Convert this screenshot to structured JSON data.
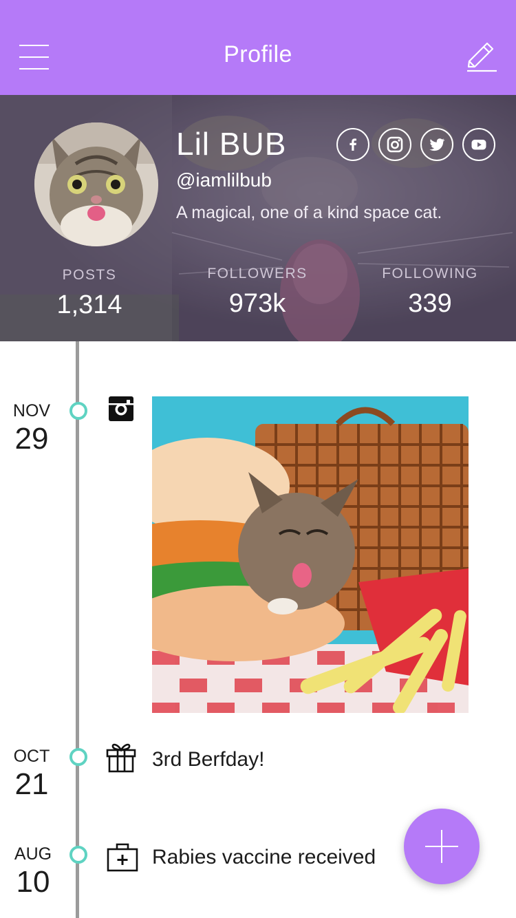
{
  "header": {
    "title": "Profile",
    "menu_icon": "hamburger-menu-icon",
    "edit_icon": "pencil-edit-icon",
    "background_color": "#b57af8"
  },
  "profile": {
    "name": "Lil BUB",
    "handle": "@iamlilbub",
    "bio": "A magical, one of a kind space cat.",
    "socials": [
      {
        "icon": "facebook-icon"
      },
      {
        "icon": "instagram-icon"
      },
      {
        "icon": "twitter-icon"
      },
      {
        "icon": "youtube-icon"
      }
    ],
    "stats": [
      {
        "label": "POSTS",
        "value": "1,314"
      },
      {
        "label": "FOLLOWERS",
        "value": "973k"
      },
      {
        "label": "FOLLOWING",
        "value": "339"
      }
    ]
  },
  "timeline": {
    "line_color": "#9b9b9b",
    "dot_color": "#5fd3c2",
    "items": [
      {
        "month": "NOV",
        "day": "29",
        "icon": "instagram-icon",
        "type": "photo"
      },
      {
        "month": "OCT",
        "day": "21",
        "icon": "gift-icon",
        "text": "3rd Berfday!"
      },
      {
        "month": "AUG",
        "day": "10",
        "icon": "medical-kit-icon",
        "text": "Rabies vaccine received"
      }
    ]
  },
  "fab": {
    "icon": "plus-icon",
    "color": "#b57af8"
  }
}
